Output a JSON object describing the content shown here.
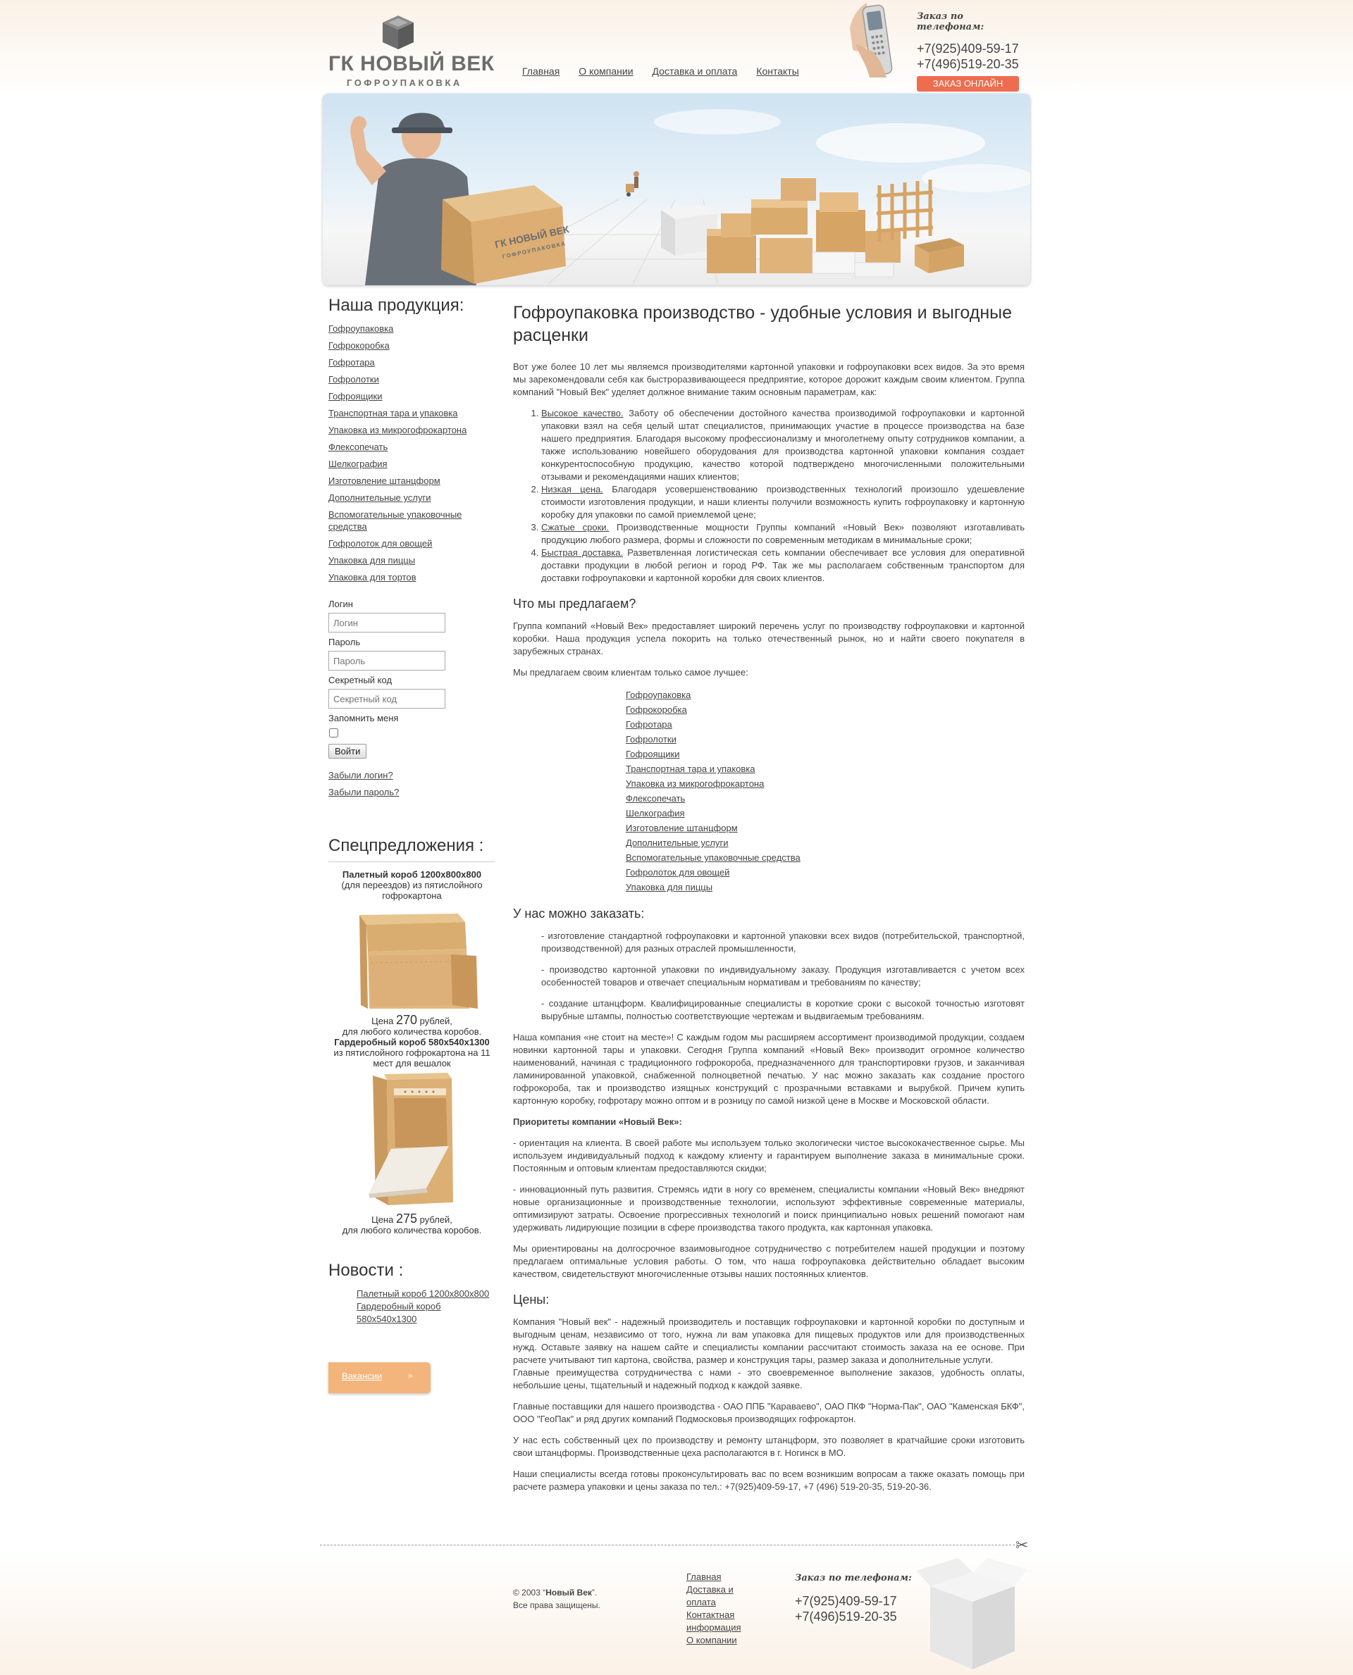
{
  "header": {
    "logo_title": "ГК НОВЫЙ ВЕК",
    "logo_sub": "ГОФРОУПАКОВКА",
    "nav": [
      "Главная",
      "О компании",
      "Доставка и оплата",
      "Контакты"
    ],
    "phone_label": "Заказ по телефонам:",
    "phone1": "+7(925)409-59-17",
    "phone2": "+7(496)519-20-35",
    "order_button": "ЗАКАЗ ОНЛАЙН"
  },
  "sidebar": {
    "products_title": "Наша продукция:",
    "products": [
      "Гофроупаковка",
      "Гофрокоробка",
      "Гофротара",
      "Гофролотки",
      "Гофроящики",
      "Транспортная тара и упаковка",
      "Упаковка из микрогофрокартона",
      "Флексопечать",
      "Шелкография",
      "Изготовление штанцформ",
      "Дополнительные услуги",
      "Вспомогательные упаковочные средства",
      "Гофролоток для овощей",
      "Упаковка для пиццы",
      "Упаковка для тортов"
    ],
    "login": {
      "login_label": "Логин",
      "login_placeholder": "Логин",
      "password_label": "Пароль",
      "password_placeholder": "Пароль",
      "code_label": "Секретный код",
      "code_placeholder": "Секретный код",
      "remember_label": "Запомнить меня",
      "submit": "Войти",
      "forgot_login": "Забыли логин?",
      "forgot_password": "Забыли пароль?"
    },
    "specials_title": "Спецпредложения :",
    "special1": {
      "name": "Палетный короб 1200х800х800",
      "desc": "(для переездов) из пятислойного гофрокартона",
      "price_prefix": "Цена",
      "price": "270",
      "price_suffix": "рублей,",
      "note": "для любого количества коробов."
    },
    "special2": {
      "name": "Гардеробный короб 580х540х1300",
      "desc": "из пятислойного гофрокартона на 11 мест для вешалок",
      "price_prefix": "Цена",
      "price": "275",
      "price_suffix": "рублей,",
      "note": "для любого количества коробов."
    },
    "news_title": "Новости :",
    "news": [
      "Палетный короб 1200х800х800",
      "Гардеробный короб 580х540х1300"
    ],
    "vacancies": "Вакансии",
    "vacancies_arrow": "»"
  },
  "main": {
    "title": "Гофроупаковка производство - удобные условия и выгодные расценки",
    "intro": "Вот уже более 10 лет мы являемся производителями картонной упаковки и гофроупаковки всех видов. За это время мы зарекомендовали себя как быстроразвивающееся предприятие, которое дорожит каждым своим клиентом. Группа компаний \"Новый Век\" уделяет должное внимание таким основным параметрам, как:",
    "params": [
      {
        "term": "Высокое качество.",
        "text": "Заботу об обеспечении достойного качества производимой гофроупаковки и картонной упаковки взял на себя целый штат специалистов, принимающих участие в процессе производства на базе нашего предприятия. Благодаря высокому профессионализму и многолетнему опыту сотрудников компании, а также использованию новейшего оборудования для производства картонной упаковки компания создает конкурентоспособную продукцию, качество которой подтверждено многочисленными положительными отзывами и рекомендациями наших клиентов;"
      },
      {
        "term": "Низкая цена.",
        "text": "Благодаря усовершенствованию производственных технологий произошло удешевление стоимости изготовления продукции, и наши клиенты получили возможность купить гофроупаковку и картонную коробку для упаковки по самой приемлемой цене;"
      },
      {
        "term": "Сжатые сроки.",
        "text": "Производственные мощности Группы компаний «Новый Век» позволяют изготавливать продукцию любого размера, формы и сложности по современным методикам в минимальные сроки;"
      },
      {
        "term": "Быстрая доставка.",
        "text": "Разветвленная логистическая сеть компании обеспечивает все условия для оперативной доставки продукции в любой регион и город РФ. Так же мы располагаем собственным транспортом для доставки гофроупаковки и картонной коробки для своих клиентов."
      }
    ],
    "offer_title": "Что мы предлагаем?",
    "offer_p1": "Группа компаний «Новый Век» предоставляет широкий перечень услуг по производству гофроупаковки и картонной коробки. Наша продукция успела покорить на только отечественный рынок, но и найти своего покупателя в зарубежных странах.",
    "offer_p2": "Мы предлагаем своим клиентам только самое лучшее:",
    "offer_links": [
      "Гофроупаковка",
      "Гофрокоробка",
      "Гофротара",
      "Гофролотки",
      "Гофроящики",
      "Транспортная тара и упаковка",
      "Упаковка из микрогофрокартона",
      "Флексопечать",
      "Шелкография",
      "Изготовление штанцформ",
      "Дополнительные услуги",
      "Вспомогательные упаковочные средства",
      "Гофролоток для овощей",
      "Упаковка для пиццы"
    ],
    "order_title": "У нас можно заказать:",
    "order_items": [
      "- изготовление стандартной гофроупаковки и картонной упаковки всех видов (потребительской, транспортной, производственной) для разных отраслей промышленности,",
      "- производство картонной упаковки по индивидуальному заказу. Продукция изготавливается с учетом всех особенностей товаров и отвечает специальным нормативам и требованиям по качеству;",
      "- создание штанцформ. Квалифицированные специалисты в короткие сроки с высокой точностью изготовят вырубные штампы, полностью соответствующие чертежам и выдвигаемым требованиям."
    ],
    "company_p": "Наша компания «не стоит на месте»! С каждым годом мы расширяем ассортимент производимой продукции, создаем новинки картонной тары и упаковки. Сегодня Группа компаний «Новый Век» производит огромное количество наименований, начиная с традиционного гофрокороба, предназначенного для транспортировки грузов, и заканчивая ламинированной упаковкой, снабженной полноцветной печатью. У нас можно заказать как создание простого гофрокороба, так и производство изящных конструкций с прозрачными вставками и вырубкой. Причем купить картонную коробку, гофротару можно оптом и в розницу по самой низкой цене в Москве и Московской области.",
    "priorities_title": "Приоритеты компании «Новый Век»:",
    "priority1": "- ориентация на клиента. В своей работе мы используем только экологически чистое высококачественное сырье. Мы используем индивидуальный подход к каждому клиенту и гарантируем выполнение заказа в минимальные сроки. Постоянным и оптовым клиентам предоставляются скидки;",
    "priority2": "- инновационный путь развития. Стремясь идти в ногу со временем, специалисты компании «Новый Век» внедряют новые организационные и производственные технологии, используют эффективные современные материалы, оптимизируют затраты. Освоение прогрессивных технологий и поиск принципиально новых решений помогают нам удерживать лидирующие позиции в сфере производства такого продукта, как картонная упаковка.",
    "cooperation": "Мы ориентированы на долгосрочное взаимовыгодное сотрудничество с потребителем нашей продукции и поэтому предлагаем оптимальные условия работы. О том, что наша гофроупаковка действительно обладает высоким качеством, свидетельствуют многочисленные отзывы наших постоянных клиентов.",
    "prices_title": "Цены:",
    "prices_p1": "Компания \"Новый век\" - надежный производитель и поставщик гофроупаковки и картонной коробки по доступным и выгодным ценам, независимо от того, нужна ли вам упаковка для пищевых продуктов или для производственных нужд. Оставьте заявку на нашем сайте и специалисты компании рассчитают стоимость заказа на ее основе. При расчете учитывают тип картона, свойства, размер и конструкция тары, размер заказа и дополнительные услуги.",
    "prices_p1b": "Главные преимущества сотрудничества с нами - это своевременное выполнение заказов, удобность оплаты, небольшие цены, тщательный и надежный подход к каждой заявке.",
    "prices_p2": "Главные поставщики для нашего производства - ОАО ППБ \"Караваево\", ОАО ПКФ \"Норма-Пак\", ОАО \"Каменская БКФ\", ООО \"ГеоПак\" и ряд других компаний Подмосковья производящих гофрокартон.",
    "prices_p3": "У нас есть собственный цех по производству и ремонту штанцформ, это позволяет в кратчайшие сроки изготовить свои штанцформы. Производственные цеха располагаются в г. Ногинск в МО.",
    "prices_p4": "Наши специалисты всегда готовы проконсультировать вас по всем возникшим вопросам а также оказать помощь при расчете размера упаковки и цены заказа по тел.: +7(925)409-59-17, +7 (496) 519-20-35, 519-20-36."
  },
  "footer": {
    "copyright_prefix": "© 2003 “",
    "copyright_name": "Новый Век",
    "copyright_suffix": "”.",
    "rights": "Все права защищены.",
    "links": [
      "Главная",
      "Доставка и оплата",
      "Контактная информация",
      "О компании"
    ],
    "phone_label": "Заказ по телефонам:",
    "phone1": "+7(925)409-59-17",
    "phone2": "+7(496)519-20-35"
  },
  "banner": {
    "box_logo": "ГК НОВЫЙ ВЕК",
    "box_logo_sub": "ГОФРОУПАКОВКА"
  },
  "colors": {
    "accent_button": "#ef6d4f",
    "vacancy_tab": "#f3b57c",
    "cardboard": "#d9ab6c"
  }
}
